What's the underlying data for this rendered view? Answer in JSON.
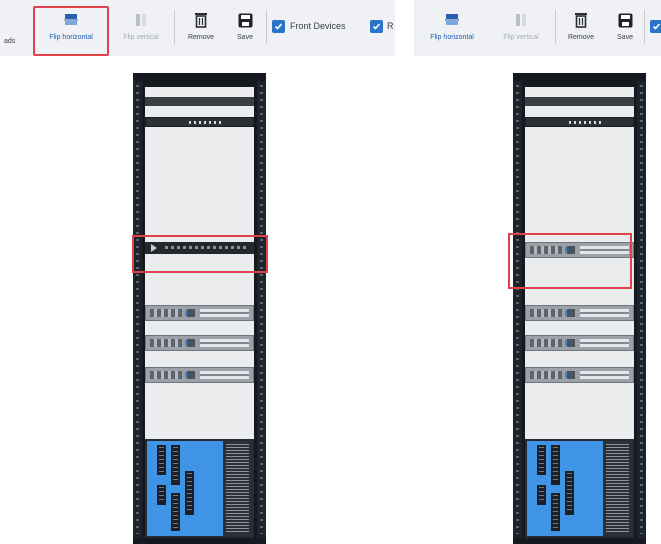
{
  "left_panel": {
    "toolbar": {
      "stub_label": "ads",
      "buttons": [
        {
          "id": "flip-horizontal",
          "label": "Flip horizontal",
          "icon": "flip-horizontal-icon",
          "state": "highlighted"
        },
        {
          "id": "flip-vertical",
          "label": "Flip vertical",
          "icon": "flip-vertical-icon",
          "state": "disabled"
        },
        {
          "id": "remove",
          "label": "Remove",
          "icon": "trash-icon",
          "state": "enabled"
        },
        {
          "id": "save",
          "label": "Save",
          "icon": "save-icon",
          "state": "enabled"
        }
      ],
      "checkboxes": [
        {
          "label": "Front Devices",
          "checked": true
        },
        {
          "label": "R",
          "checked": true
        }
      ]
    },
    "highlighted_device": "black-1u-server"
  },
  "right_panel": {
    "toolbar": {
      "buttons": [
        {
          "id": "flip-horizontal",
          "label": "Flip horizontal",
          "icon": "flip-horizontal-icon",
          "state": "enabled"
        },
        {
          "id": "flip-vertical",
          "label": "Flip vertical",
          "icon": "flip-vertical-icon",
          "state": "disabled"
        },
        {
          "id": "remove",
          "label": "Remove",
          "icon": "trash-icon",
          "state": "enabled"
        },
        {
          "id": "save",
          "label": "Save",
          "icon": "save-icon",
          "state": "enabled"
        }
      ],
      "checkboxes": [
        {
          "label": "",
          "checked": true
        }
      ]
    },
    "highlighted_device": "grey-2u-server"
  },
  "colors": {
    "toolbar_bg": "#eff1f4",
    "highlight_red": "#e0424a",
    "checkbox_blue": "#2a74c9",
    "rack_frame": "#161a20",
    "storage_blue": "#3f94e6"
  }
}
